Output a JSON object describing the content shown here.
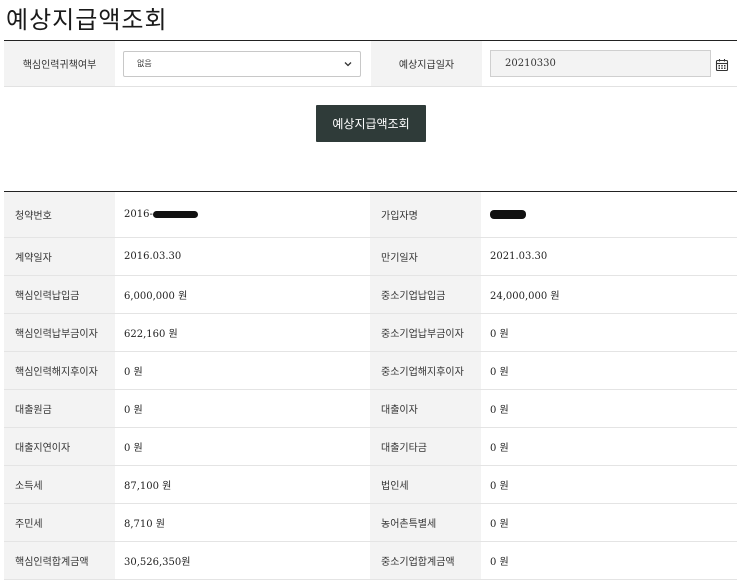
{
  "page": {
    "title": "예상지급액조회"
  },
  "search": {
    "retire_label": "핵심인력귀책여부",
    "retire_value": "없음",
    "date_label": "예상지급일자",
    "date_value": "20210330",
    "button_label": "예상지급액조회"
  },
  "rows": [
    {
      "l1": "청약번호",
      "v1": "2016-",
      "l2": "가입자명",
      "v2": ""
    },
    {
      "l1": "계약일자",
      "v1": "2016.03.30",
      "l2": "만기일자",
      "v2": "2021.03.30"
    },
    {
      "l1": "핵심인력납입금",
      "v1": "6,000,000 원",
      "l2": "중소기업납입금",
      "v2": "24,000,000 원"
    },
    {
      "l1": "핵심인력납부금이자",
      "v1": "622,160 원",
      "l2": "중소기업납부금이자",
      "v2": "0 원"
    },
    {
      "l1": "핵심인력해지후이자",
      "v1": "0 원",
      "l2": "중소기업해지후이자",
      "v2": "0 원"
    },
    {
      "l1": "대출원금",
      "v1": "0 원",
      "l2": "대출이자",
      "v2": "0 원"
    },
    {
      "l1": "대출지연이자",
      "v1": "0 원",
      "l2": "대출기타금",
      "v2": "0 원"
    },
    {
      "l1": "소득세",
      "v1": "87,100 원",
      "l2": "법인세",
      "v2": "0 원"
    },
    {
      "l1": "주민세",
      "v1": "8,710 원",
      "l2": "농어촌특별세",
      "v2": "0 원"
    },
    {
      "l1": "핵심인력합계금액",
      "v1": "30,526,350원",
      "l2": "중소기업합계금액",
      "v2": "0 원"
    }
  ]
}
